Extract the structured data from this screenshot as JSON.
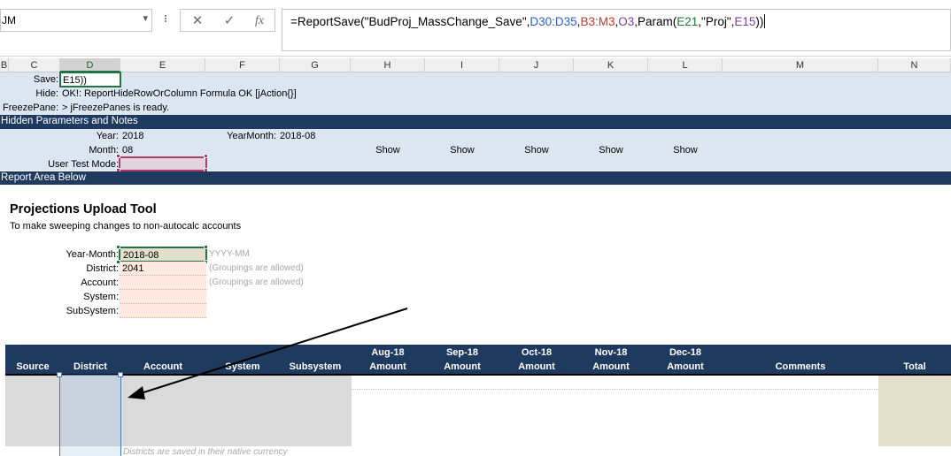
{
  "formula_bar": {
    "name_box": "JM",
    "cancel_symbol": "✕",
    "enter_symbol": "✓",
    "fx_label": "fx",
    "formula_parts": [
      {
        "text": "=ReportSave(\"BudProj_MassChange_Save\",",
        "color": "default"
      },
      {
        "text": "D30:D35",
        "color": "blue"
      },
      {
        "text": ",",
        "color": "default"
      },
      {
        "text": "B3:M3",
        "color": "red"
      },
      {
        "text": ",",
        "color": "default"
      },
      {
        "text": "O3",
        "color": "purple"
      },
      {
        "text": ",Param(",
        "color": "default"
      },
      {
        "text": "E21",
        "color": "green"
      },
      {
        "text": ",\"Proj\",",
        "color": "default"
      },
      {
        "text": "E15",
        "color": "purple"
      },
      {
        "text": "))",
        "color": "default"
      }
    ]
  },
  "columns": [
    "B",
    "C",
    "D",
    "E",
    "F",
    "G",
    "H",
    "I",
    "J",
    "K",
    "L",
    "M",
    "N"
  ],
  "selected_column": "D",
  "hidden_area": {
    "save_label": "Save:",
    "save_value": "E15))",
    "hide_label": "Hide:",
    "hide_value": "OK!: ReportHideRowOrColumn Formula OK [jAction{}]",
    "freeze_label": "FreezePane:",
    "freeze_value": "> jFreezePanes is ready."
  },
  "hidden_params_header": "Hidden Parameters and Notes",
  "params": {
    "year_label": "Year:",
    "year_value": "2018",
    "yearmonth_label": "YearMonth:",
    "yearmonth_value": "2018-08",
    "month_label": "Month:",
    "month_value": "08",
    "user_test_mode_label": "User Test Mode:",
    "show_labels": [
      "Show",
      "Show",
      "Show",
      "Show",
      "Show"
    ]
  },
  "report_area_header": "Report Area Below",
  "report": {
    "title": "Projections Upload Tool",
    "subtitle": "To make sweeping changes to non-autocalc accounts",
    "fields": {
      "year_month_label": "Year-Month:",
      "year_month_value": "2018-08",
      "year_month_hint": "YYYY-MM",
      "district_label": "District:",
      "district_value": "2041",
      "district_hint": "(Groupings are allowed)",
      "account_label": "Account:",
      "account_hint": "(Groupings are allowed)",
      "system_label": "System:",
      "subsystem_label": "SubSystem:"
    }
  },
  "table": {
    "headers": [
      {
        "top": "",
        "bottom": "Source"
      },
      {
        "top": "",
        "bottom": "District"
      },
      {
        "top": "",
        "bottom": "Account"
      },
      {
        "top": "",
        "bottom": "System"
      },
      {
        "top": "",
        "bottom": "Subsystem"
      },
      {
        "top": "Aug-18",
        "bottom": "Amount"
      },
      {
        "top": "Sep-18",
        "bottom": "Amount"
      },
      {
        "top": "Oct-18",
        "bottom": "Amount"
      },
      {
        "top": "Nov-18",
        "bottom": "Amount"
      },
      {
        "top": "Dec-18",
        "bottom": "Amount"
      },
      {
        "top": "",
        "bottom": "Comments"
      },
      {
        "top": "",
        "bottom": "Total"
      }
    ],
    "footnote": "Districts are saved in their native currency"
  },
  "colors": {
    "accent_green": "#217346",
    "dark_band": "#1f3a5f",
    "light_band": "#dce6f1",
    "input_fill": "#fde9e0",
    "tan_fill": "#e4dfcb"
  }
}
